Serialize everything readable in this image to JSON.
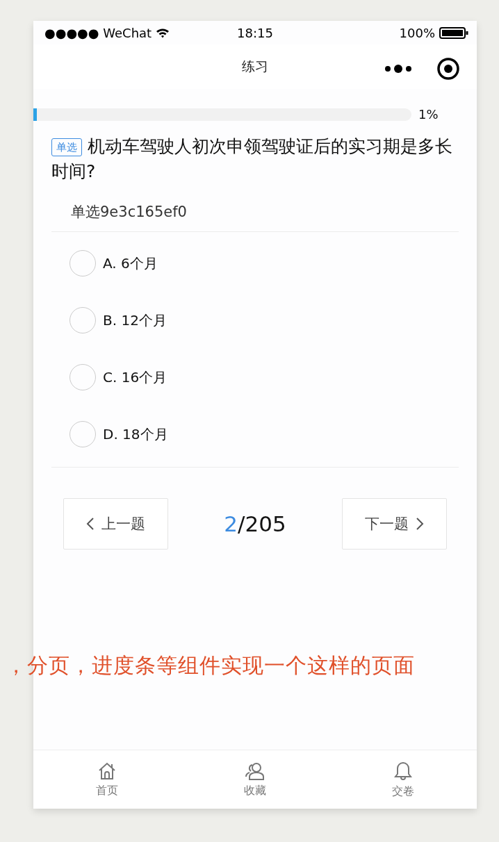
{
  "status_bar": {
    "carrier": "●●●●● WeChat",
    "time": "18:15",
    "battery": "100%"
  },
  "nav_bar": {
    "title": "练习"
  },
  "progress": {
    "level": 0.01,
    "reading": "1%"
  },
  "question": {
    "type_tag": "单选",
    "text": "机动车驾驶人初次申领驾驶证后的实习期是多长时间?",
    "group_title": "单选9e3c165ef0"
  },
  "options": [
    {
      "label": "A. 6个月",
      "selected": false
    },
    {
      "label": "B. 12个月",
      "selected": false
    },
    {
      "label": "C. 16个月",
      "selected": false
    },
    {
      "label": "D. 18个月",
      "selected": false
    }
  ],
  "pager": {
    "prev": "上一题",
    "current": "2",
    "total": "/205",
    "next": "下一题"
  },
  "annotation": "，分页，进度条等组件实现一个这样的页面",
  "tab_bar": [
    {
      "label": "首页",
      "kind": "home"
    },
    {
      "label": "收藏",
      "kind": "user"
    },
    {
      "label": "交卷",
      "kind": "bell"
    }
  ]
}
